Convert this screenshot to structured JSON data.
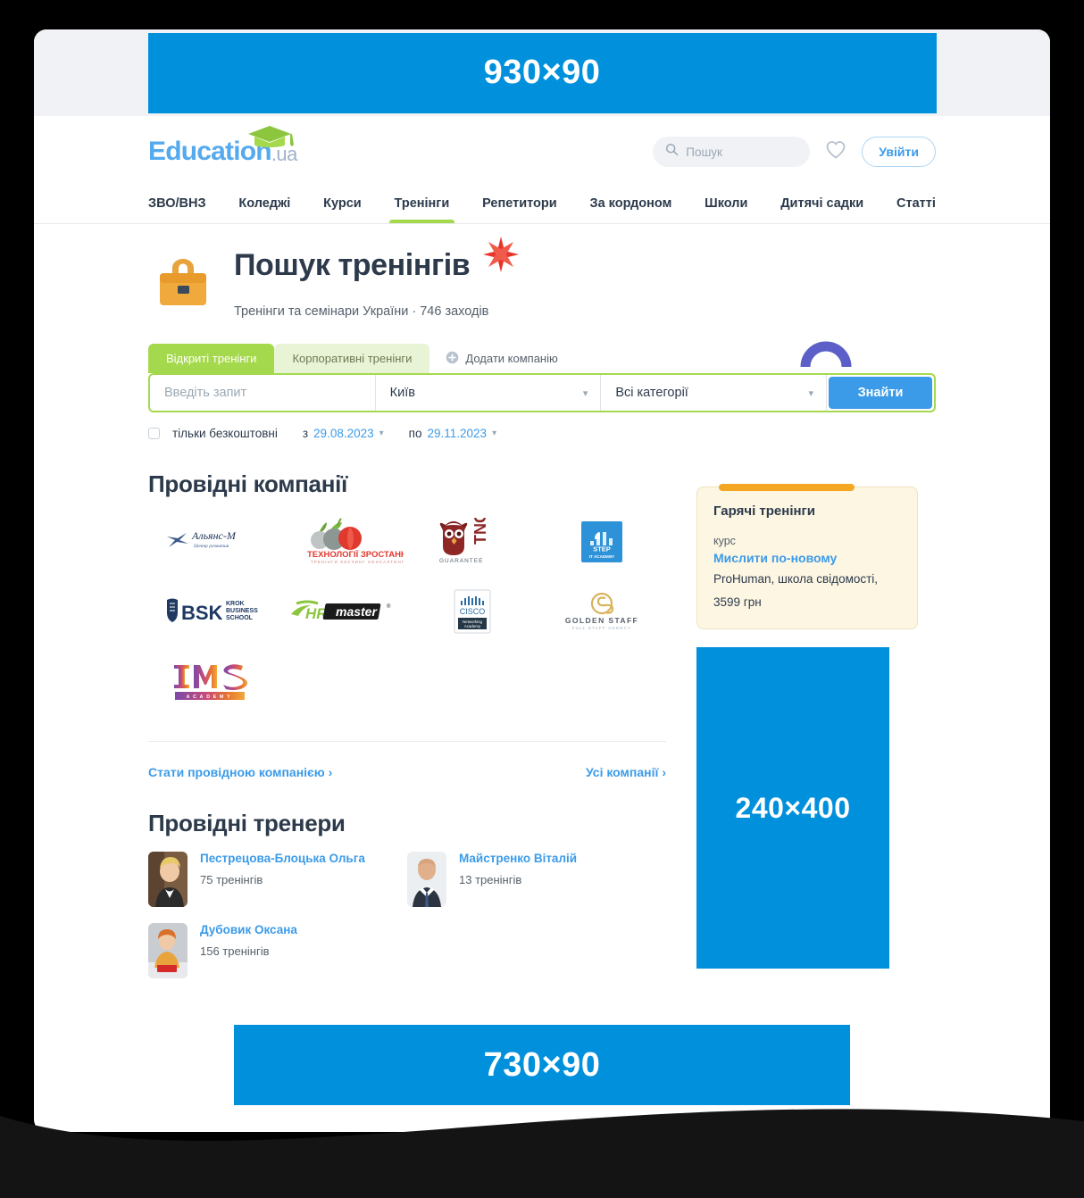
{
  "ads": {
    "top": {
      "label": "930×90",
      "color": "#0090DC"
    },
    "side": {
      "label": "240×400",
      "color": "#0090DC"
    },
    "bottom": {
      "label": "730×90",
      "color": "#0090DC"
    }
  },
  "header": {
    "logo_main": "Education",
    "logo_tld": ".ua",
    "search_placeholder": "Пошук",
    "search_value": "",
    "login_label": "Увійти"
  },
  "nav": {
    "items": [
      {
        "label": "ЗВО/ВНЗ",
        "active": false
      },
      {
        "label": "Коледжі",
        "active": false
      },
      {
        "label": "Курси",
        "active": false
      },
      {
        "label": "Тренінги",
        "active": true
      },
      {
        "label": "Репетитори",
        "active": false
      },
      {
        "label": "За кордоном",
        "active": false
      },
      {
        "label": "Школи",
        "active": false
      },
      {
        "label": "Дитячі садки",
        "active": false
      },
      {
        "label": "Статті",
        "active": false
      }
    ],
    "active_color": "#A5D94D"
  },
  "page_head": {
    "title": "Пошук тренінгів",
    "subtitle": "Тренінги та семінари України · 746 заходів"
  },
  "search_panel": {
    "tabs": [
      {
        "label": "Відкриті тренінги",
        "active": true
      },
      {
        "label": "Корпоративні тренінги",
        "active": false
      }
    ],
    "add_company_label": "Додати компанію",
    "query_placeholder": "Введіть запит",
    "query_value": "",
    "city_value": "Київ",
    "category_value": "Всі категорії",
    "submit_label": "Знайти",
    "free_only_label": "тільки безкоштовні",
    "free_only_checked": false,
    "date_from_label": "з",
    "date_from_value": "29.08.2023",
    "date_to_label": "по",
    "date_to_value": "29.11.2023"
  },
  "companies_section": {
    "title": "Провідні компанії",
    "logos": [
      {
        "name": "Альянс-М",
        "sub": "Центр развития"
      },
      {
        "name": "ТЕХНОЛОГІЇ ЗРОСТАННЯ",
        "sub": "ТРЕНІНГИ КОУЧИНГ КОНСАЛТИНГ"
      },
      {
        "name": "TNG",
        "sub": "GUARANTEE"
      },
      {
        "name": "STEP",
        "sub": "IT ACADEMY"
      },
      {
        "name": "BSK",
        "sub": "KROK BUSINESS SCHOOL"
      },
      {
        "name": "HRmaster",
        "sub": ""
      },
      {
        "name": "CISCO",
        "sub": "Networking Academy"
      },
      {
        "name": "GOLDEN STAFF",
        "sub": "FULL STAFF AGENCY"
      },
      {
        "name": "IMS",
        "sub": "ACADEMY"
      }
    ],
    "become_link": "Стати провідною компанією",
    "all_link": "Усі компанії"
  },
  "trainers_section": {
    "title": "Провідні тренери",
    "items": [
      {
        "name": "Пестрецова-Блоцька Ольга",
        "count": "75 тренінгів"
      },
      {
        "name": "Майстренко Віталій",
        "count": "13 тренінгів"
      },
      {
        "name": "Дубовик Оксана",
        "count": "156 тренінгів"
      }
    ]
  },
  "hot_card": {
    "title": "Гарячі тренінги",
    "kind": "курс",
    "name": "Мислити по-новому",
    "provider": "ProHuman, школа свідомості,",
    "price": "3599 грн"
  }
}
